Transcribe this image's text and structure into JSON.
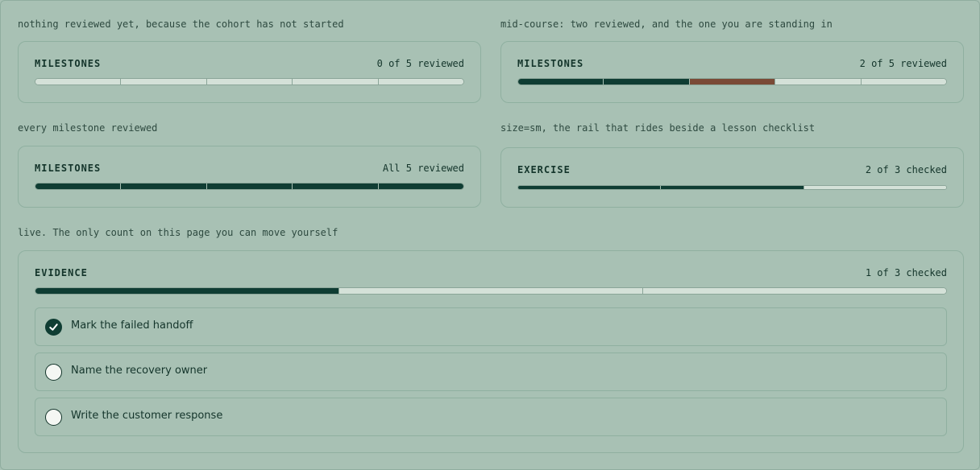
{
  "examples": [
    {
      "caption": "nothing reviewed yet, because the cohort has not started",
      "title": "MILESTONES",
      "count": "0 of 5 reviewed",
      "segments": [
        "todo",
        "todo",
        "todo",
        "todo",
        "todo"
      ]
    },
    {
      "caption": "mid-course: two reviewed, and the one you are standing in",
      "title": "MILESTONES",
      "count": "2 of 5 reviewed",
      "segments": [
        "done",
        "done",
        "current",
        "todo",
        "todo"
      ]
    },
    {
      "caption": "every milestone reviewed",
      "title": "MILESTONES",
      "count": "All 5 reviewed",
      "segments": [
        "done",
        "done",
        "done",
        "done",
        "done"
      ]
    },
    {
      "caption": "size=sm, the rail that rides beside a lesson checklist",
      "title": "EXERCISE",
      "count": "2 of 3 checked",
      "segments": [
        "done",
        "done",
        "todo"
      ]
    }
  ],
  "live": {
    "caption": "live. The only count on this page you can move yourself",
    "title": "EVIDENCE",
    "count": "1 of 3 checked",
    "segments": [
      "done",
      "todo",
      "todo"
    ],
    "items": [
      {
        "label": "Mark the failed handoff",
        "checked": true
      },
      {
        "label": "Name the recovery owner",
        "checked": false
      },
      {
        "label": "Write the customer response",
        "checked": false
      }
    ]
  },
  "colors": {
    "background": "#a8c1b4",
    "done": "#0f3d33",
    "current": "#7a4a36",
    "todo": "#d4e1d8"
  }
}
